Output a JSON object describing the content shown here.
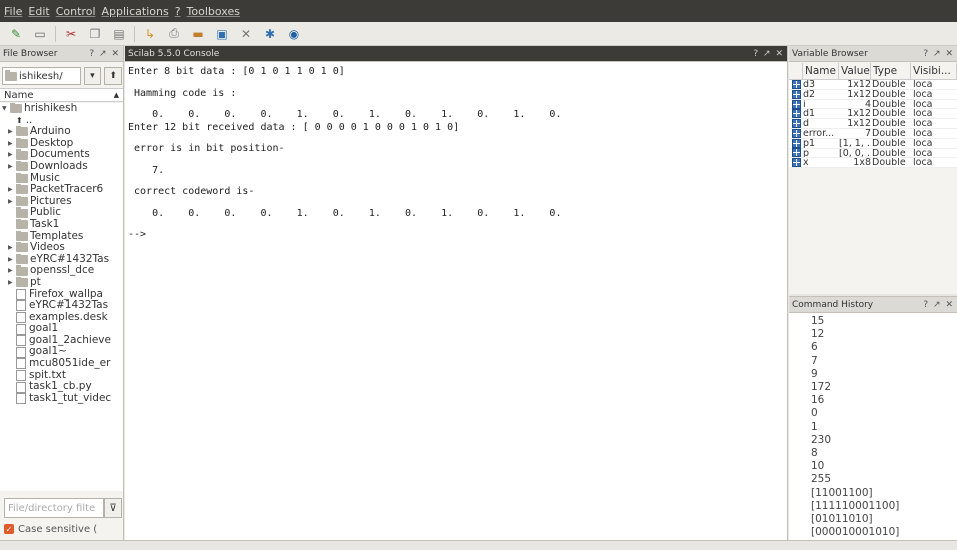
{
  "menu": [
    "File",
    "Edit",
    "Control",
    "Applications",
    "?",
    "Toolboxes"
  ],
  "file_browser": {
    "title": "File Browser",
    "path": "ishikesh/",
    "column": "Name",
    "tree": [
      {
        "label": "hrishikesh",
        "type": "folder",
        "indent": 0,
        "arrow": "▼"
      },
      {
        "label": "..",
        "type": "up",
        "indent": 1,
        "arrow": ""
      },
      {
        "label": "Arduino",
        "type": "folder",
        "indent": 1,
        "arrow": "▶"
      },
      {
        "label": "Desktop",
        "type": "folder",
        "indent": 1,
        "arrow": "▶"
      },
      {
        "label": "Documents",
        "type": "folder",
        "indent": 1,
        "arrow": "▶"
      },
      {
        "label": "Downloads",
        "type": "folder",
        "indent": 1,
        "arrow": "▶"
      },
      {
        "label": "Music",
        "type": "folder",
        "indent": 1,
        "arrow": ""
      },
      {
        "label": "PacketTracer6",
        "type": "folder",
        "indent": 1,
        "arrow": "▶"
      },
      {
        "label": "Pictures",
        "type": "folder",
        "indent": 1,
        "arrow": "▶"
      },
      {
        "label": "Public",
        "type": "folder",
        "indent": 1,
        "arrow": ""
      },
      {
        "label": "Task1",
        "type": "folder",
        "indent": 1,
        "arrow": ""
      },
      {
        "label": "Templates",
        "type": "folder",
        "indent": 1,
        "arrow": ""
      },
      {
        "label": "Videos",
        "type": "folder",
        "indent": 1,
        "arrow": "▶"
      },
      {
        "label": "eYRC#1432Tas",
        "type": "folder",
        "indent": 1,
        "arrow": "▶"
      },
      {
        "label": "openssl_dce",
        "type": "folder",
        "indent": 1,
        "arrow": "▶"
      },
      {
        "label": "pt",
        "type": "folder",
        "indent": 1,
        "arrow": "▶"
      },
      {
        "label": "Firefox_wallpa",
        "type": "file",
        "indent": 1,
        "arrow": ""
      },
      {
        "label": "eYRC#1432Tas",
        "type": "file",
        "indent": 1,
        "arrow": ""
      },
      {
        "label": "examples.desk",
        "type": "file",
        "indent": 1,
        "arrow": ""
      },
      {
        "label": "goal1",
        "type": "file",
        "indent": 1,
        "arrow": ""
      },
      {
        "label": "goal1_2achieve",
        "type": "file",
        "indent": 1,
        "arrow": ""
      },
      {
        "label": "goal1~",
        "type": "file",
        "indent": 1,
        "arrow": ""
      },
      {
        "label": "mcu8051ide_er",
        "type": "file",
        "indent": 1,
        "arrow": ""
      },
      {
        "label": "spit.txt",
        "type": "file",
        "indent": 1,
        "arrow": ""
      },
      {
        "label": "task1_cb.py",
        "type": "file",
        "indent": 1,
        "arrow": ""
      },
      {
        "label": "task1_tut_videc",
        "type": "file",
        "indent": 1,
        "arrow": ""
      }
    ],
    "filter_placeholder": "File/directory filte",
    "case_sensitive": "Case sensitive ("
  },
  "console": {
    "title": "Scilab 5.5.0 Console",
    "lines": [
      "Enter 8 bit data : [0 1 0 1 1 0 1 0]",
      "",
      " Hamming code is :",
      "",
      "    0.    0.    0.    0.    1.    0.    1.    0.    1.    0.    1.    0.",
      "Enter 12 bit received data : [ 0 0 0 0 1 0 0 0 1 0 1 0]",
      "",
      " error is in bit position-",
      "",
      "    7.",
      "",
      " correct codeword is-",
      "",
      "    0.    0.    0.    0.    1.    0.    1.    0.    1.    0.    1.    0.",
      "",
      "-->"
    ]
  },
  "variable_browser": {
    "title": "Variable Browser",
    "columns": [
      "Name",
      "Value",
      "Type",
      "Visibi..."
    ],
    "rows": [
      {
        "name": "d3",
        "value": "1x12",
        "type": "Double",
        "vis": "loca"
      },
      {
        "name": "d2",
        "value": "1x12",
        "type": "Double",
        "vis": "loca"
      },
      {
        "name": "i",
        "value": "4",
        "type": "Double",
        "vis": "loca"
      },
      {
        "name": "d1",
        "value": "1x12",
        "type": "Double",
        "vis": "loca"
      },
      {
        "name": "d",
        "value": "1x12",
        "type": "Double",
        "vis": "loca"
      },
      {
        "name": "error...",
        "value": "7",
        "type": "Double",
        "vis": "loca"
      },
      {
        "name": "p1",
        "value": "[1, 1, ...",
        "type": "Double",
        "vis": "loca"
      },
      {
        "name": "p",
        "value": "[0, 0, ...",
        "type": "Double",
        "vis": "loca"
      },
      {
        "name": "x",
        "value": "1x8",
        "type": "Double",
        "vis": "loca"
      }
    ]
  },
  "command_history": {
    "title": "Command History",
    "items": [
      "15",
      "12",
      "6",
      "7",
      "9",
      "172",
      "16",
      "0",
      "1",
      "230",
      "8",
      "10",
      "255",
      "[11001100]",
      "[111110001100]",
      "[01011010]",
      "[000010001010]"
    ]
  },
  "panel_controls": "? ↗ ✕"
}
